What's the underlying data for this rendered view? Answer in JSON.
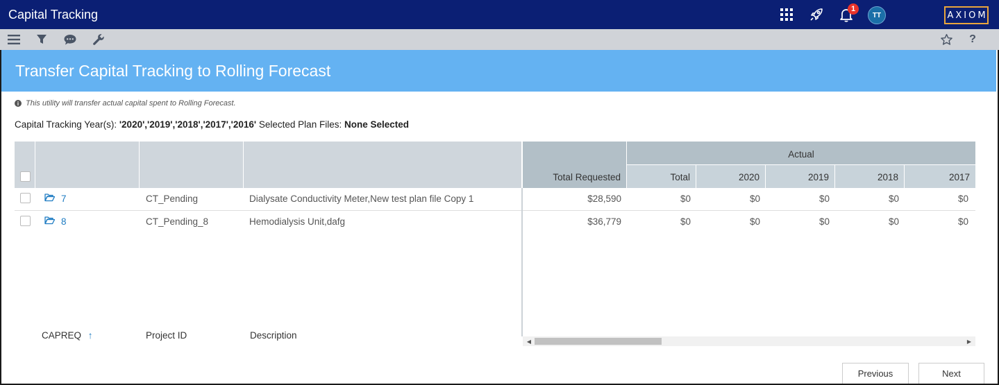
{
  "app": {
    "title": "Capital Tracking",
    "logo": "AXIOM",
    "notification_count": "1",
    "avatar_initials": "TT"
  },
  "icons": {
    "apps": "grid-icon",
    "launch": "rocket-icon",
    "notifications": "bell-icon",
    "menu": "hamburger-icon",
    "filter": "filter-icon",
    "comments": "chat-icon",
    "tools": "wrench-icon",
    "favorite": "star-icon",
    "help": "question-icon"
  },
  "colors": {
    "topbar": "#0b1f74",
    "banner": "#64b2f2",
    "link": "#1d7bc2",
    "badge": "#e8332a",
    "logo_border": "#e9a53c"
  },
  "page": {
    "title": "Transfer Capital Tracking to Rolling Forecast",
    "info": "This utility will transfer actual capital spent to Rolling Forecast.",
    "years_label": "Capital Tracking Year(s):",
    "years_value": "'2020','2019','2018','2017','2016'",
    "plan_files_label": "Selected Plan Files:",
    "plan_files_value": "None Selected"
  },
  "grid": {
    "headers": {
      "capreq": "CAPREQ",
      "sort_indicator": "↑",
      "project_id": "Project ID",
      "description": "Description",
      "total_requested": "Total Requested",
      "actual_group": "Actual",
      "total": "Total",
      "y2020": "2020",
      "y2019": "2019",
      "y2018": "2018",
      "y2017": "2017"
    },
    "rows": [
      {
        "capreq": "7",
        "project_id": "CT_Pending",
        "description": "Dialysate Conductivity Meter,New test plan file Copy 1",
        "total_requested": "$28,590",
        "total": "$0",
        "y2020": "$0",
        "y2019": "$0",
        "y2018": "$0",
        "y2017": "$0"
      },
      {
        "capreq": "8",
        "project_id": "CT_Pending_8",
        "description": "Hemodialysis Unit,dafg",
        "total_requested": "$36,779",
        "total": "$0",
        "y2020": "$0",
        "y2019": "$0",
        "y2018": "$0",
        "y2017": "$0"
      }
    ]
  },
  "buttons": {
    "previous": "Previous",
    "next": "Next"
  }
}
